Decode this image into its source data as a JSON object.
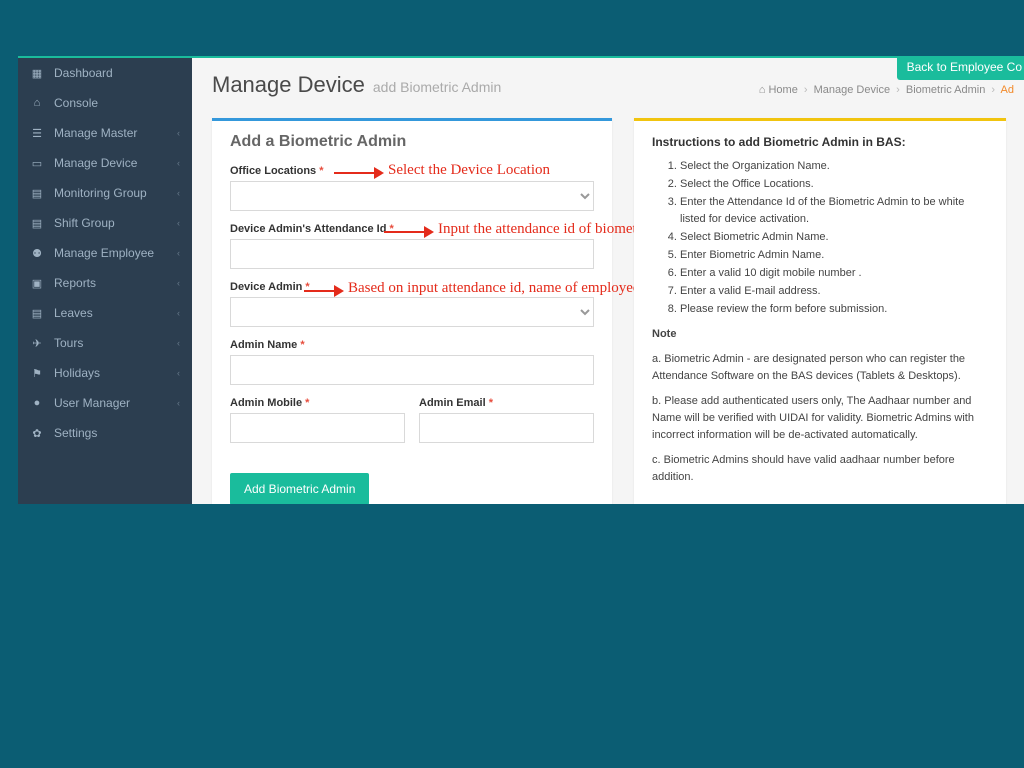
{
  "sidebar": {
    "items": [
      {
        "icon": "dashboard",
        "label": "Dashboard",
        "expandable": false
      },
      {
        "icon": "home",
        "label": "Console",
        "expandable": false
      },
      {
        "icon": "sliders",
        "label": "Manage Master",
        "expandable": true
      },
      {
        "icon": "laptop",
        "label": "Manage Device",
        "expandable": true
      },
      {
        "icon": "calendar",
        "label": "Monitoring Group",
        "expandable": true
      },
      {
        "icon": "calendar",
        "label": "Shift Group",
        "expandable": true
      },
      {
        "icon": "users",
        "label": "Manage Employee",
        "expandable": true
      },
      {
        "icon": "briefcase",
        "label": "Reports",
        "expandable": true
      },
      {
        "icon": "calendar",
        "label": "Leaves",
        "expandable": true
      },
      {
        "icon": "plane",
        "label": "Tours",
        "expandable": true
      },
      {
        "icon": "flag",
        "label": "Holidays",
        "expandable": true
      },
      {
        "icon": "user",
        "label": "User Manager",
        "expandable": true
      },
      {
        "icon": "gear",
        "label": "Settings",
        "expandable": false
      }
    ]
  },
  "header": {
    "title": "Manage Device",
    "subtitle": "add Biometric Admin",
    "back_button": "Back to Employee Co",
    "breadcrumb": [
      "Home",
      "Manage Device",
      "Biometric Admin",
      "Ad"
    ]
  },
  "form": {
    "panel_title": "Add a Biometric Admin",
    "office_locations_label": "Office Locations",
    "office_locations_value": "",
    "attendance_id_label": "Device Admin's Attendance Id",
    "attendance_id_value": "",
    "device_admin_label": "Device Admin",
    "device_admin_value": "",
    "admin_name_label": "Admin Name",
    "admin_name_value": "",
    "admin_mobile_label": "Admin Mobile",
    "admin_mobile_value": "",
    "admin_email_label": "Admin Email",
    "admin_email_value": "",
    "submit_label": "Add Biometric Admin"
  },
  "callouts": {
    "c1": "Select the Device Location",
    "c2": "Input the attendance id of biometric admin",
    "c3": "Based on input attendance id, name of employee will appear in drop-down"
  },
  "instructions": {
    "title": "Instructions to add Biometric Admin in BAS:",
    "steps": [
      "Select the Organization Name.",
      "Select the Office Locations.",
      "Enter the Attendance Id of the Biometric Admin to be white listed for device activation.",
      "Select Biometric Admin Name.",
      "Enter Biometric Admin Name.",
      "Enter a valid 10 digit mobile number .",
      "Enter a valid E-mail address.",
      "Please review the form before submission."
    ],
    "note_label": "Note",
    "note_a": "a. Biometric Admin - are designated person who can register the Attendance Software on the BAS devices (Tablets & Desktops).",
    "note_b": "b. Please add authenticated users only, The Aadhaar number and Name will be verified with UIDAI for validity. Biometric Admins with incorrect information will be de-activated automatically.",
    "note_c": "c. Biometric Admins should have valid aadhaar number before addition."
  }
}
